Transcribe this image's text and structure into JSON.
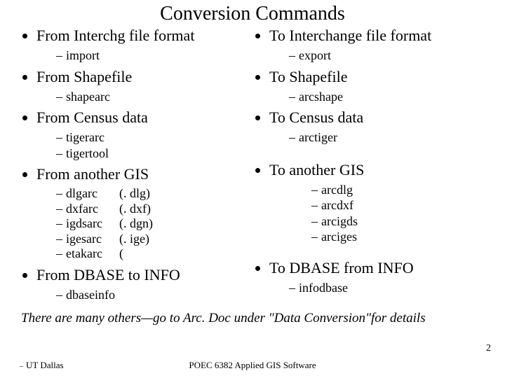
{
  "title": "Conversion Commands",
  "left": {
    "b1": {
      "h": "From Interchg file format",
      "items": [
        "import"
      ]
    },
    "b2": {
      "h": "From Shapefile",
      "items": [
        "shapearc"
      ]
    },
    "b3": {
      "h": "From Census data",
      "items": [
        "tigerarc",
        "tigertool"
      ]
    },
    "b4": {
      "h": "From another GIS",
      "cmds": [
        "dlgarc",
        "dxfarc",
        "igdsarc",
        "igesarc",
        "etakarc"
      ],
      "exts": [
        "(. dlg)",
        "(. dxf)",
        "(. dgn)",
        "(. ige)",
        "("
      ]
    },
    "b5": {
      "h": "From DBASE to INFO",
      "items": [
        "dbaseinfo"
      ]
    }
  },
  "right": {
    "b1": {
      "h": "To Interchange file format",
      "items": [
        "export"
      ]
    },
    "b2": {
      "h": "To Shapefile",
      "items": [
        "arcshape"
      ]
    },
    "b3": {
      "h": "To Census data",
      "items": [
        "arctiger"
      ]
    },
    "b4": {
      "h": "To another GIS",
      "items": [
        "arcdlg",
        "arcdxf",
        "arcigds",
        "arciges"
      ]
    },
    "b5": {
      "h": "To DBASE from INFO",
      "items": [
        "infodbase"
      ]
    }
  },
  "note": "There are many others—go to Arc. Doc under \"Data Conversion\"for details",
  "page_number": "2",
  "footer_left": "UT Dallas",
  "footer_center": "POEC 6382 Applied GIS Software"
}
